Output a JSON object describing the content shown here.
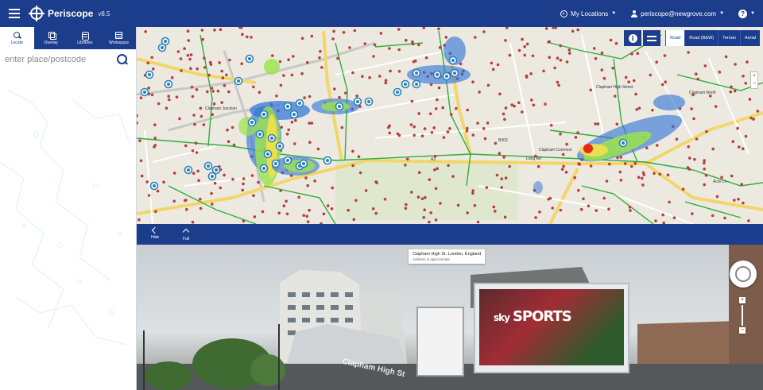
{
  "header": {
    "app_name": "Periscope",
    "app_version": "v8.5",
    "my_locations": "My Locations",
    "user_email": "periscope@newgrove.com"
  },
  "sidebar": {
    "tabs": [
      {
        "label": "Locate",
        "icon": "search-icon"
      },
      {
        "label": "Overlay",
        "icon": "layers-icon"
      },
      {
        "label": "Libraries",
        "icon": "database-icon"
      },
      {
        "label": "Workspace",
        "icon": "workspace-icon"
      }
    ],
    "search_placeholder": "enter place/postcode"
  },
  "map": {
    "map_types": [
      "Road",
      "Road (B&W)",
      "Terrain",
      "Aerial"
    ],
    "active_map_type": "Road",
    "labels": {
      "clapham_junction": "Clapham Junction",
      "clapham_high_street": "Clapham High Street",
      "clapham_north": "Clapham North",
      "clapham_common": "Clapham Common",
      "a3": "A3",
      "b303": "B303",
      "acre_ln": "Acre Ln",
      "long_rd": "Long Rd"
    },
    "colors": {
      "heat_low": "#2b6fd6",
      "heat_mid": "#9be34a",
      "heat_high": "#e62b1e",
      "boundary": "#2fae3a",
      "pin": "#2c7fb8",
      "dot": "#b5403a",
      "road_major": "#f3d66a"
    }
  },
  "divider": {
    "hide_label": "Hide",
    "full_label": "Full"
  },
  "street_view": {
    "address": "Clapham High St, London, England",
    "address_note": "Address is approximate",
    "billboard_text": "SPORTS",
    "billboard_brand": "sky",
    "street_sign": "Clapham High St"
  }
}
